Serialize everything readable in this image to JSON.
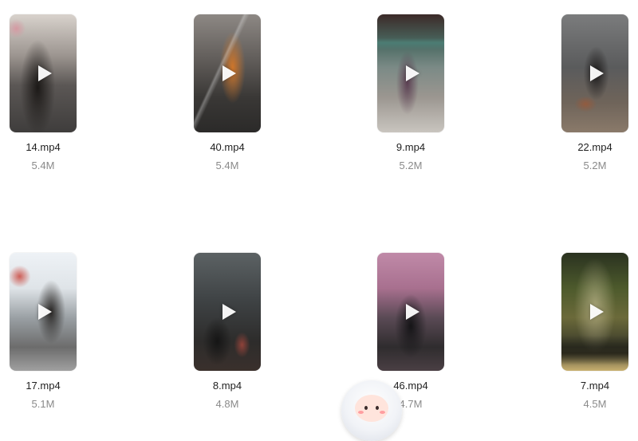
{
  "files": [
    {
      "name": "14.mp4",
      "size": "5.4M",
      "thumb_colors": [
        "#c9c2bc",
        "#4a4a4a",
        "#8a6b5a"
      ],
      "icon": "play-icon"
    },
    {
      "name": "40.mp4",
      "size": "5.4M",
      "thumb_colors": [
        "#6f6a66",
        "#2d2b2a",
        "#c77a2a"
      ],
      "icon": "play-icon"
    },
    {
      "name": "9.mp4",
      "size": "5.2M",
      "thumb_colors": [
        "#3f6a63",
        "#b8b3ac",
        "#6a4b5a"
      ],
      "icon": "play-icon"
    },
    {
      "name": "22.mp4",
      "size": "5.2M",
      "thumb_colors": [
        "#6e6f70",
        "#3a3635",
        "#8a7a6a"
      ],
      "icon": "play-icon"
    },
    {
      "name": "17.mp4",
      "size": "5.1M",
      "thumb_colors": [
        "#e8edf2",
        "#3e3a38",
        "#c0392b"
      ],
      "icon": "play-icon"
    },
    {
      "name": "8.mp4",
      "size": "4.8M",
      "thumb_colors": [
        "#4f5456",
        "#2a2827",
        "#8b4a3a"
      ],
      "icon": "play-icon"
    },
    {
      "name": "46.mp4",
      "size": "4.7M",
      "thumb_colors": [
        "#b27a9a",
        "#2a2a2c",
        "#8c5a7a"
      ],
      "icon": "play-icon"
    },
    {
      "name": "7.mp4",
      "size": "4.5M",
      "thumb_colors": [
        "#4a5a2a",
        "#1f2418",
        "#c9b060"
      ],
      "icon": "play-icon"
    }
  ],
  "assistant": {
    "icon": "assistant-avatar-icon"
  }
}
